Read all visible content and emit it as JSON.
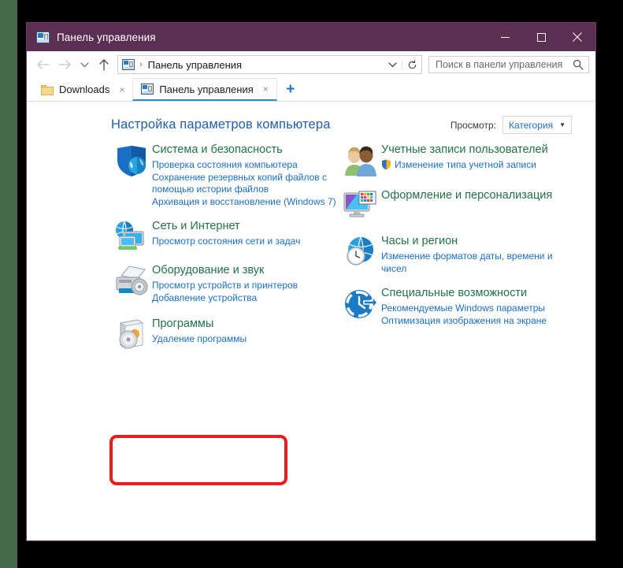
{
  "window": {
    "title": "Панель управления",
    "title_icon": "control-panel-icon",
    "buttons": {
      "minimize": "minimize-icon",
      "maximize": "maximize-icon",
      "close": "close-icon"
    }
  },
  "navbar": {
    "back": "back-arrow-icon",
    "forward": "forward-arrow-icon",
    "recent": "chevron-down-icon",
    "up": "up-arrow-icon",
    "breadcrumb_icon": "control-panel-icon",
    "breadcrumb_separator": "›",
    "breadcrumb": "Панель управления",
    "address_chevron": "chevron-down-icon",
    "refresh": "refresh-icon"
  },
  "search": {
    "placeholder": "Поиск в панели управления",
    "value": "",
    "icon": "search-icon"
  },
  "tabs": [
    {
      "label": "Downloads",
      "icon": "folder-icon",
      "close": "×",
      "active": false
    },
    {
      "label": "Панель управления",
      "icon": "control-panel-icon",
      "close": "×",
      "active": true
    }
  ],
  "new_tab_label": "+",
  "page": {
    "title": "Настройка параметров компьютера",
    "view_label": "Просмотр:",
    "view_value": "Категория",
    "view_arrow": "▼"
  },
  "categories_left": [
    {
      "icon": "shield-security-icon",
      "title": "Система и безопасность",
      "links": [
        {
          "text": "Проверка состояния компьютера",
          "shield": false
        },
        {
          "text": "Сохранение резервных копий файлов с помощью истории файлов",
          "shield": false
        },
        {
          "text": "Архивация и восстановление (Windows 7)",
          "shield": false
        }
      ]
    },
    {
      "icon": "network-globe-icon",
      "title": "Сеть и Интернет",
      "links": [
        {
          "text": "Просмотр состояния сети и задач",
          "shield": false
        }
      ]
    },
    {
      "icon": "printer-hardware-icon",
      "title": "Оборудование и звук",
      "links": [
        {
          "text": "Просмотр устройств и принтеров",
          "shield": false
        },
        {
          "text": "Добавление устройства",
          "shield": false
        }
      ]
    },
    {
      "icon": "programs-cd-icon",
      "title": "Программы",
      "links": [
        {
          "text": "Удаление программы",
          "shield": false
        }
      ]
    }
  ],
  "categories_right": [
    {
      "icon": "user-accounts-icon",
      "title": "Учетные записи пользователей",
      "links": [
        {
          "text": "Изменение типа учетной записи",
          "shield": true
        }
      ]
    },
    {
      "icon": "appearance-monitor-icon",
      "title": "Оформление и персонализация",
      "links": []
    },
    {
      "icon": "clock-region-icon",
      "title": "Часы и регион",
      "links": [
        {
          "text": "Изменение форматов даты, времени и чисел",
          "shield": false
        }
      ]
    },
    {
      "icon": "ease-of-access-icon",
      "title": "Специальные возможности",
      "links": [
        {
          "text": "Рекомендуемые Windows параметры",
          "shield": false
        },
        {
          "text": "Оптимизация изображения на экране",
          "shield": false
        }
      ]
    }
  ],
  "highlight": {
    "name": "programs-highlight",
    "color": "#ef1c1c"
  },
  "colors": {
    "titlebar": "#5c2f52",
    "category_title": "#217346",
    "link": "#1a6fc4",
    "page_title": "#1f5fae",
    "highlight": "#ef1c1c",
    "tab_active_underline": "#2d8ccc",
    "outer_edge": "#46684a"
  }
}
